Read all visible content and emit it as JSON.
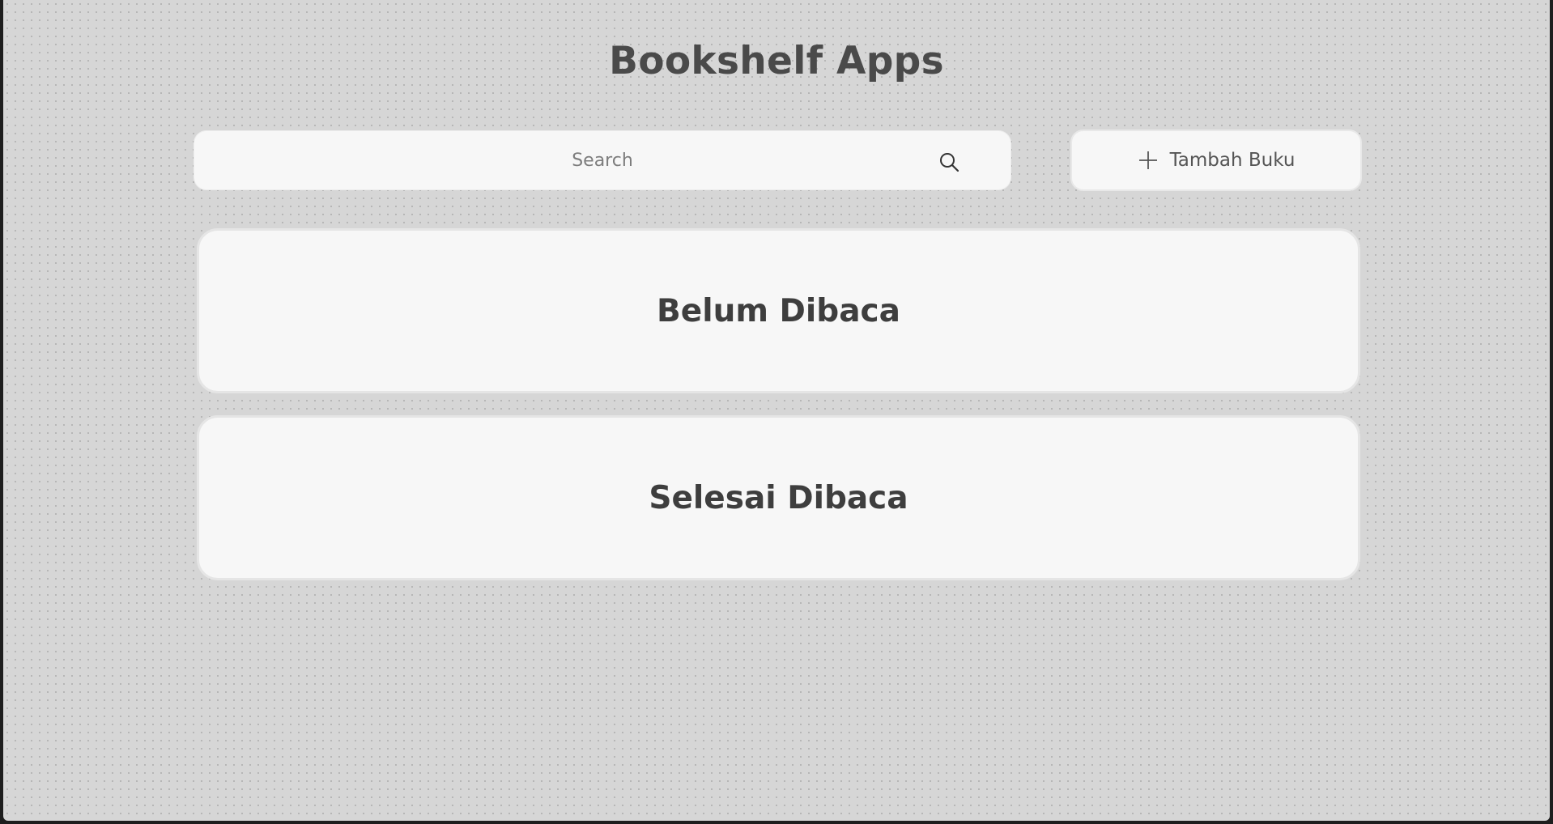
{
  "app": {
    "title": "Bookshelf Apps"
  },
  "search": {
    "placeholder": "Search",
    "value": "",
    "icon": "search-icon"
  },
  "add_book": {
    "label": "Tambah Buku",
    "icon": "plus-icon"
  },
  "shelves": [
    {
      "title": "Belum Dibaca"
    },
    {
      "title": "Selesai Dibaca"
    }
  ],
  "colors": {
    "background": "#d6d6d6",
    "card": "#f7f7f7",
    "title_text": "#4a4a4a",
    "shelf_text": "#3e3e3e"
  }
}
